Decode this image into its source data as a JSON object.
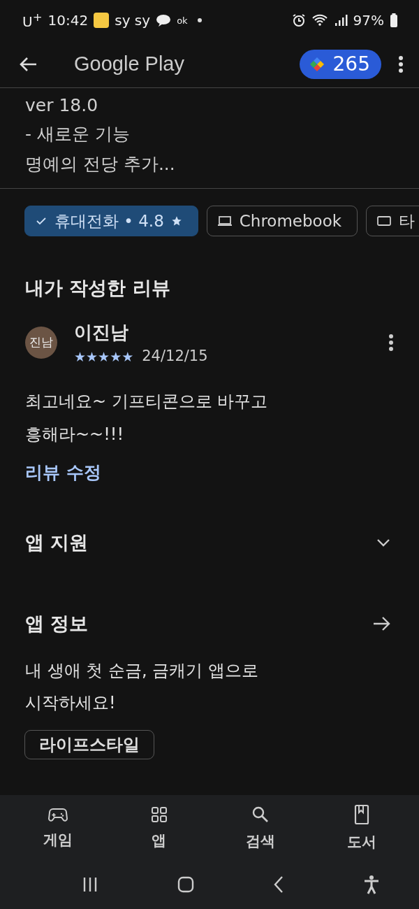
{
  "status_bar": {
    "carrier": "U$^{+}$",
    "time": "10:42",
    "notif_text": "sy sy",
    "notif_ok": "ok",
    "battery": "97%"
  },
  "app_bar": {
    "title": "Google Play",
    "points": "265"
  },
  "whats_new": [
    "ver 18.0",
    "- 새로운 기능",
    "명예의 전당 추가..."
  ],
  "device_chips": [
    {
      "kind": "phone",
      "label": "휴대전화 • 4.8",
      "selected": true
    },
    {
      "kind": "laptop",
      "label": "Chromebook",
      "selected": false
    },
    {
      "kind": "tablet",
      "label": "타",
      "selected": false
    }
  ],
  "my_review": {
    "heading": "내가 작성한 리뷰",
    "avatar": "진남",
    "author": "이진남",
    "stars": 5,
    "date": "24/12/15",
    "text": "최고네요~ 기프티콘으로 바꾸고\n흥해라~~!!!",
    "edit_link": "리뷰 수정"
  },
  "app_support": {
    "title": "앱 지원",
    "expanded": false
  },
  "app_info": {
    "title": "앱 정보",
    "description": "내 생애 첫 순금, 금캐기 앱으로\n시작하세요!",
    "tags": [
      "라이프스타일"
    ]
  },
  "bottom_nav": [
    {
      "kind": "games",
      "label": "게임"
    },
    {
      "kind": "apps",
      "label": "앱"
    },
    {
      "kind": "search",
      "label": "검색"
    },
    {
      "kind": "books",
      "label": "도서"
    }
  ]
}
